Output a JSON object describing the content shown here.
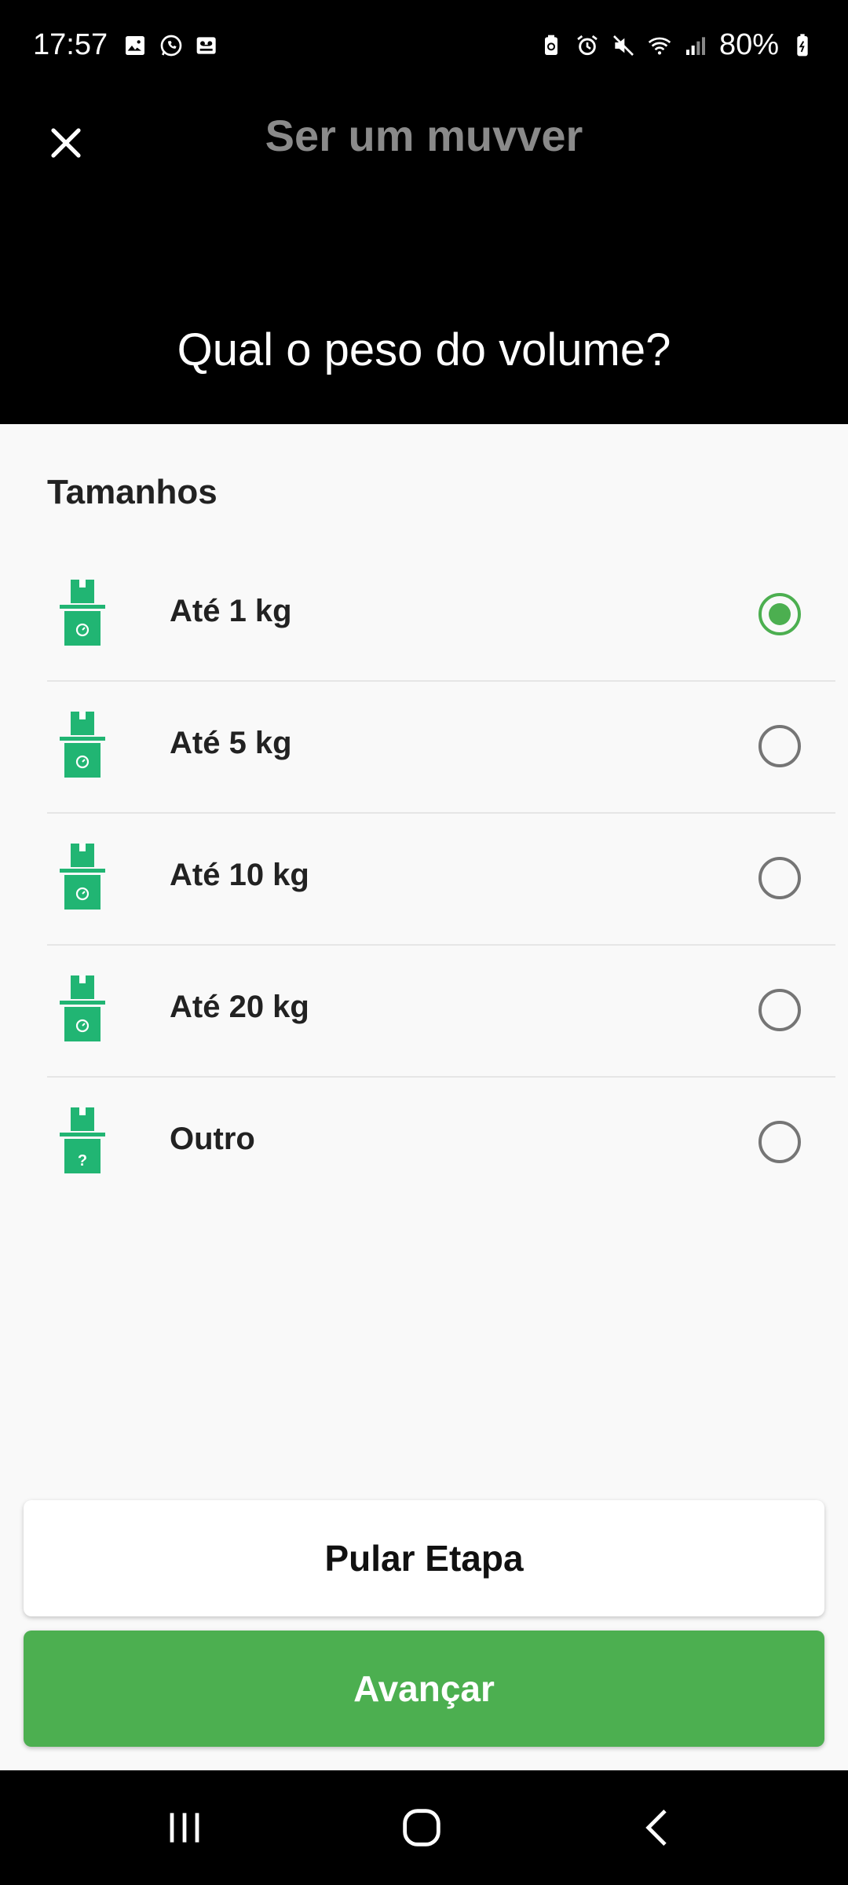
{
  "status_bar": {
    "time": "17:57",
    "battery": "80%",
    "left_icons": [
      "image-icon",
      "whatsapp-icon",
      "voicemail-icon"
    ],
    "right_icons": [
      "battery-saver-icon",
      "alarm-icon",
      "mute-icon",
      "wifi-icon",
      "signal-icon",
      "battery-icon"
    ]
  },
  "header": {
    "title": "Ser um muvver",
    "question": "Qual o peso do volume?"
  },
  "section": {
    "title": "Tamanhos"
  },
  "options": [
    {
      "label": "Até 1 kg",
      "icon": "package-weight-icon",
      "selected": true
    },
    {
      "label": "Até 5 kg",
      "icon": "package-weight-icon",
      "selected": false
    },
    {
      "label": "Até 10 kg",
      "icon": "package-weight-icon",
      "selected": false
    },
    {
      "label": "Até 20 kg",
      "icon": "package-weight-icon",
      "selected": false
    },
    {
      "label": "Outro",
      "icon": "package-question-icon",
      "selected": false
    }
  ],
  "buttons": {
    "skip": "Pular Etapa",
    "next": "Avançar"
  },
  "colors": {
    "accent": "#4caf50",
    "header_bg": "#000000",
    "content_bg": "#f9f9f9",
    "title_gray": "#8a8a8a"
  },
  "nav_bar": {
    "buttons": [
      "recent-apps-icon",
      "home-icon",
      "back-icon"
    ]
  }
}
